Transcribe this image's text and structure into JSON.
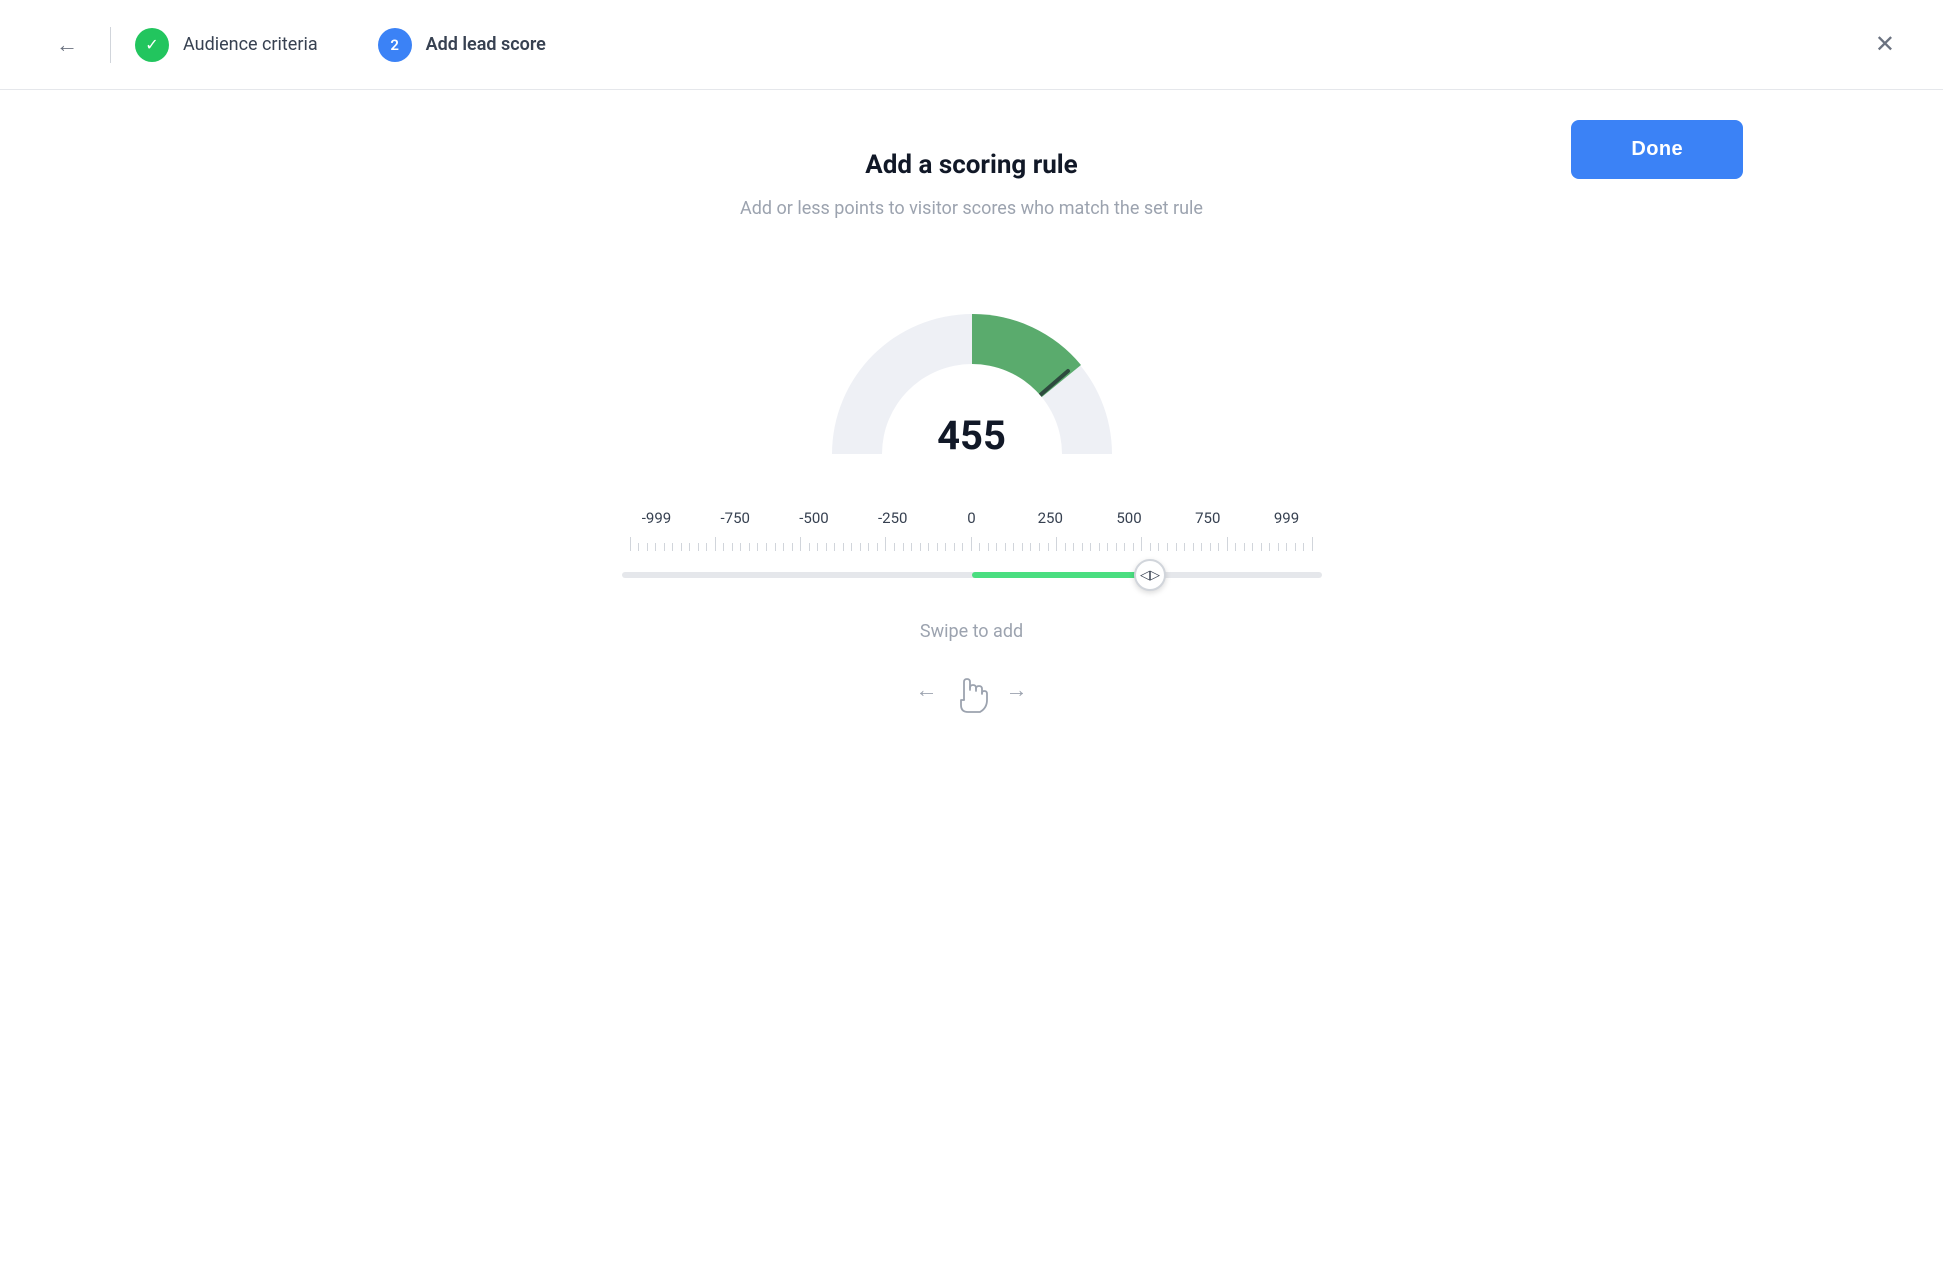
{
  "header": {
    "back_label": "←",
    "close_label": "✕",
    "step1": {
      "label": "Audience criteria",
      "circle_content": "✓"
    },
    "step2": {
      "label": "Add lead score",
      "circle_content": "2"
    }
  },
  "toolbar": {
    "done_label": "Done"
  },
  "main": {
    "title": "Add a scoring rule",
    "subtitle": "Add or less points to visitor scores who match the set rule",
    "gauge_value": "455",
    "swipe_label": "Swipe to add"
  },
  "slider": {
    "labels": [
      "-999",
      "-750",
      "-500",
      "-250",
      "0",
      "250",
      "500",
      "750",
      "999"
    ],
    "value": 455,
    "min": -999,
    "max": 999
  },
  "colors": {
    "green_check": "#22c55e",
    "blue_step": "#3b82f6",
    "done_btn": "#3b82f6",
    "gauge_green": "#5aab6d",
    "gauge_bg": "#f0f1f5",
    "slider_fill": "#4ade80"
  }
}
